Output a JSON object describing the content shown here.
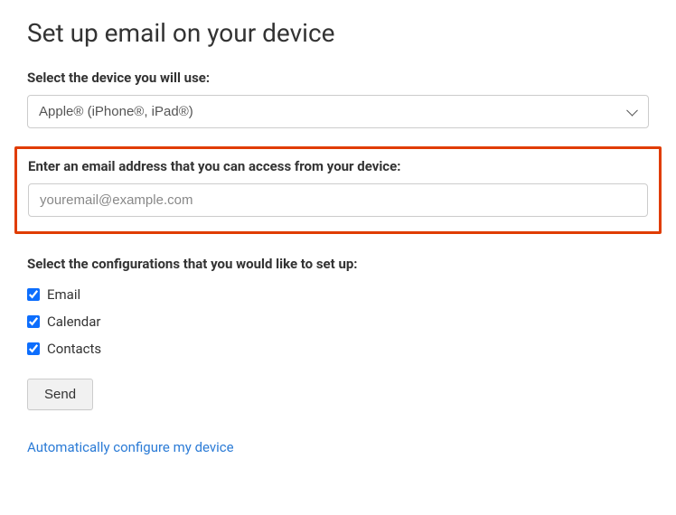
{
  "title": "Set up email on your device",
  "device": {
    "label": "Select the device you will use:",
    "selected": "Apple® (iPhone®, iPad®)"
  },
  "email": {
    "label": "Enter an email address that you can access from your device:",
    "placeholder": "youremail@example.com"
  },
  "configs": {
    "label": "Select the configurations that you would like to set up:",
    "items": [
      {
        "label": "Email",
        "checked": true
      },
      {
        "label": "Calendar",
        "checked": true
      },
      {
        "label": "Contacts",
        "checked": true
      }
    ]
  },
  "send_label": "Send",
  "auto_link": "Automatically configure my device"
}
